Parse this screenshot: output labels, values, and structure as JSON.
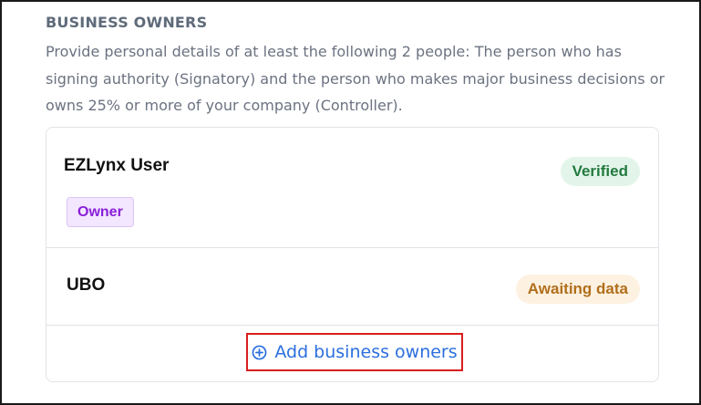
{
  "section": {
    "title": "BUSINESS OWNERS",
    "description": "Provide personal details of at least the following 2 people: The person who has signing authority (Signatory) and the person who makes major business decisions or owns 25% or more of your company (Controller)."
  },
  "owners": [
    {
      "name": "EZLynx User",
      "status": "Verified",
      "role": "Owner"
    },
    {
      "name": "UBO",
      "status": "Awaiting data"
    }
  ],
  "actions": {
    "add_owner_label": "Add business owners",
    "add_icon": "plus-circle-icon"
  },
  "colors": {
    "verified_text": "#237a3f",
    "verified_bg": "#e3f5ea",
    "awaiting_text": "#b06f1c",
    "awaiting_bg": "#fdf1e1",
    "role_text": "#8a1fd8",
    "role_bg": "#f3e6ff",
    "link": "#2b6fde",
    "highlight_border": "#d81e1e"
  }
}
